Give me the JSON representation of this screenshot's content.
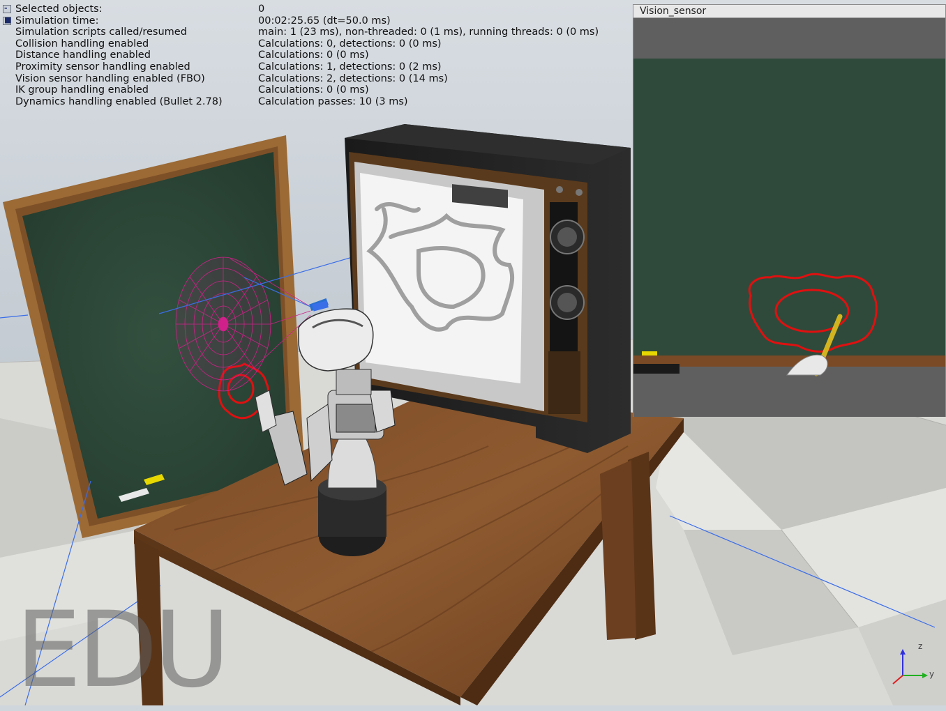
{
  "info": [
    {
      "icon": "collapse-icon",
      "glyph": "-",
      "label": "Selected objects:",
      "value": "0"
    },
    {
      "icon": "square-icon",
      "glyph": "■",
      "label": "Simulation time:",
      "value": "00:02:25.65 (dt=50.0 ms)"
    },
    {
      "icon": "",
      "glyph": "",
      "label": "Simulation scripts called/resumed",
      "value": "main: 1 (23 ms), non-threaded: 0 (1 ms), running threads: 0 (0 ms)"
    },
    {
      "icon": "",
      "glyph": "",
      "label": "Collision handling enabled",
      "value": "Calculations: 0, detections: 0 (0 ms)"
    },
    {
      "icon": "",
      "glyph": "",
      "label": "Distance handling enabled",
      "value": "Calculations: 0 (0 ms)"
    },
    {
      "icon": "",
      "glyph": "",
      "label": "Proximity sensor handling enabled",
      "value": "Calculations: 1, detections: 0 (2 ms)"
    },
    {
      "icon": "",
      "glyph": "",
      "label": "Vision sensor handling enabled (FBO)",
      "value": "Calculations: 2, detections: 0 (14 ms)"
    },
    {
      "icon": "",
      "glyph": "",
      "label": "IK group handling enabled",
      "value": "Calculations: 0 (0 ms)"
    },
    {
      "icon": "",
      "glyph": "",
      "label": "Dynamics handling enabled (Bullet 2.78)",
      "value": "Calculation passes: 10 (3 ms)"
    }
  ],
  "vision_window": {
    "title": "Vision_sensor"
  },
  "watermark": "EDU",
  "axes": {
    "z": "z",
    "y": "y"
  },
  "colors": {
    "chalkboard": "#2f4a3a",
    "drawing": "#e01010",
    "sensor_cone": "#d0208a",
    "ray": "#3a6ee8"
  }
}
